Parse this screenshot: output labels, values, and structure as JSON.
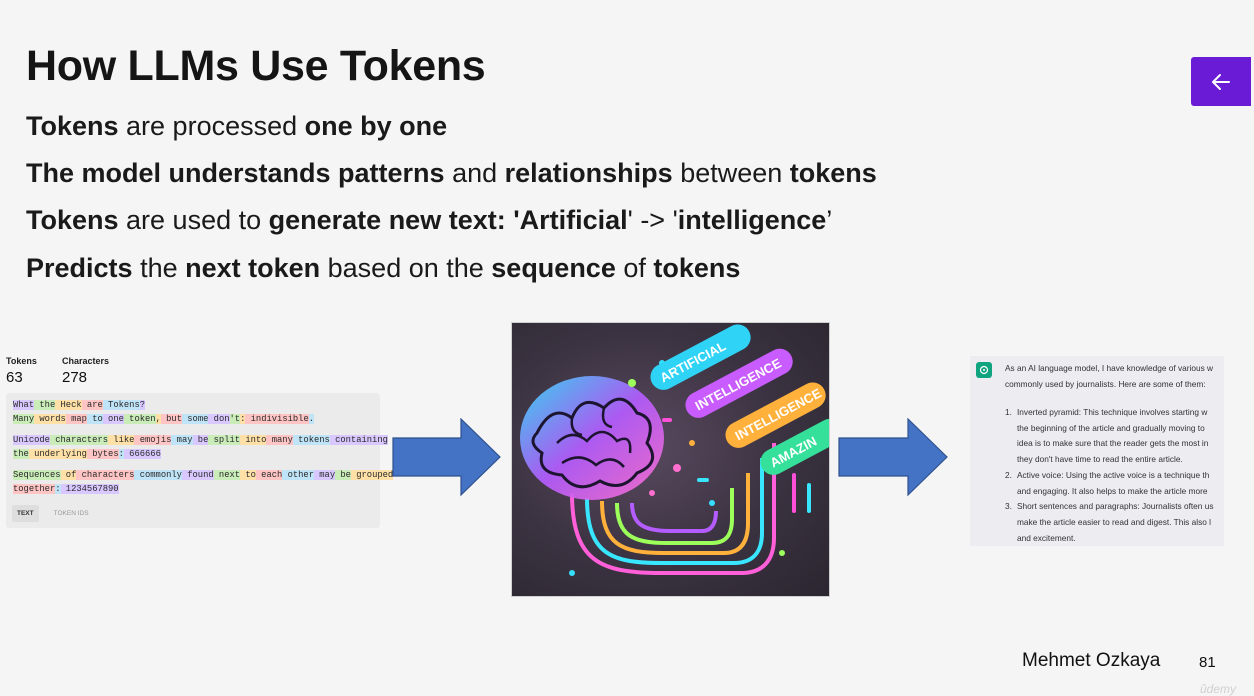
{
  "slide": {
    "title": "How LLMs Use Tokens",
    "bullets": [
      [
        {
          "t": "Tokens",
          "b": true
        },
        {
          "t": " are processed ",
          "b": false
        },
        {
          "t": "one by one",
          "b": true
        }
      ],
      [
        {
          "t": "The model understands patterns",
          "b": true
        },
        {
          "t": " and ",
          "b": false
        },
        {
          "t": "relationships",
          "b": true
        },
        {
          "t": " between ",
          "b": false
        },
        {
          "t": "tokens",
          "b": true
        }
      ],
      [
        {
          "t": "Tokens",
          "b": true
        },
        {
          "t": " are used to ",
          "b": false
        },
        {
          "t": "generate new text: 'Artificial",
          "b": true
        },
        {
          "t": "' -> '",
          "b": false
        },
        {
          "t": "intelligence",
          "b": true
        },
        {
          "t": "’",
          "b": false
        }
      ],
      [
        {
          "t": "Predicts",
          "b": true
        },
        {
          "t": " the ",
          "b": false
        },
        {
          "t": "next token",
          "b": true
        },
        {
          "t": " based on the ",
          "b": false
        },
        {
          "t": "sequence",
          "b": true
        },
        {
          "t": " of ",
          "b": false
        },
        {
          "t": "tokens",
          "b": true
        }
      ]
    ],
    "author": "Mehmet Ozkaya",
    "page_number": "81",
    "watermark": "ûdemy",
    "accent_color": "#6a1bd6"
  },
  "nav": {
    "back_icon": "arrow-left-icon"
  },
  "tokenizer": {
    "tokens_label": "Tokens",
    "tokens_value": "63",
    "characters_label": "Characters",
    "characters_value": "278",
    "lines": [
      [
        "What",
        " the",
        " Heck",
        " are",
        " Tokens",
        "?"
      ],
      [
        "Many",
        " words",
        " map",
        " to",
        " one",
        " token",
        ",",
        " but",
        " some",
        " don",
        "'t",
        ":",
        " indivisible",
        "."
      ],
      [],
      [
        "Unicode",
        " characters",
        " like",
        " emojis",
        " may",
        " be",
        " split",
        " into",
        " many",
        " tokens",
        " containing"
      ],
      [
        " the",
        " underlying",
        " bytes",
        ":",
        " 666666"
      ],
      [],
      [
        "Sequences",
        " of",
        " characters",
        " commonly",
        " found",
        " next",
        " to",
        " each",
        " other",
        " may",
        " be",
        " grouped"
      ],
      [
        " together",
        ":",
        " 1234567890"
      ]
    ],
    "tabs": [
      "TEXT",
      "TOKEN IDS"
    ]
  },
  "image": {
    "pills": [
      "ARTIFICIAL",
      "INTELLIGENCE",
      "INTELLIGENCE",
      "AMAZIN"
    ],
    "pill_colors": [
      "#2fd3f5",
      "#c85cff",
      "#ffb13b",
      "#35e09a"
    ]
  },
  "chat": {
    "intro": [
      "As an AI language model, I have knowledge of various w",
      "commonly used by journalists. Here are some of them:"
    ],
    "items": [
      {
        "num": "1.",
        "lines": [
          "Inverted pyramid: This technique involves starting w",
          "the beginning of the article and gradually moving to",
          "idea is to make sure that the reader gets the most in",
          "they don't have time to read the entire article."
        ]
      },
      {
        "num": "2.",
        "lines": [
          "Active voice: Using the active voice is a technique th",
          "and engaging. It also helps to make the article more"
        ]
      },
      {
        "num": "3.",
        "lines": [
          "Short sentences and paragraphs: Journalists often us",
          "make the article easier to read and digest. This also l",
          "and excitement."
        ]
      }
    ]
  }
}
